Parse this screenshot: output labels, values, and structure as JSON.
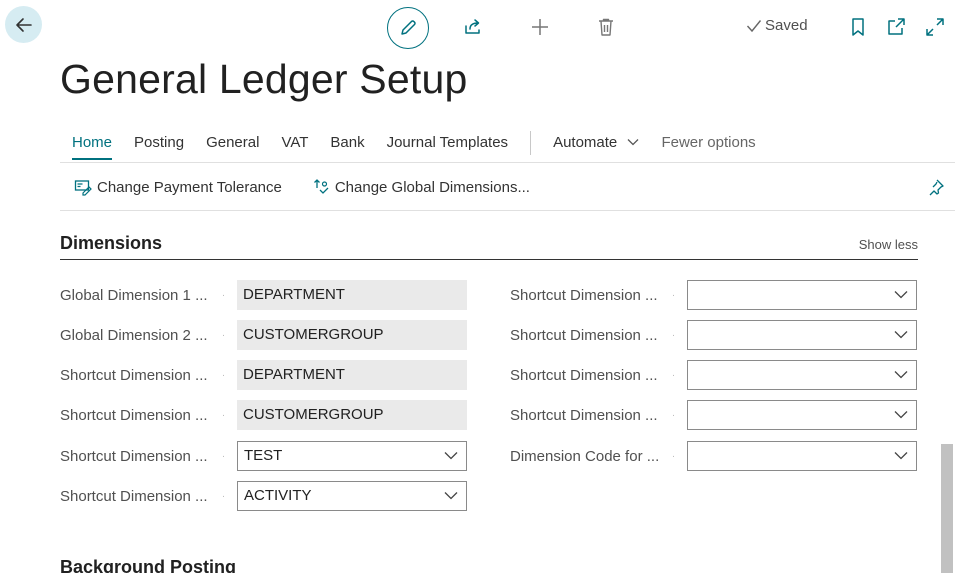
{
  "header": {
    "saved_label": "Saved",
    "page_title": "General Ledger Setup"
  },
  "tabs": {
    "home": "Home",
    "posting": "Posting",
    "general": "General",
    "vat": "VAT",
    "bank": "Bank",
    "journal_templates": "Journal Templates",
    "automate": "Automate",
    "fewer_options": "Fewer options"
  },
  "actions": {
    "change_payment_tolerance": "Change Payment Tolerance",
    "change_global_dimensions": "Change Global Dimensions..."
  },
  "section": {
    "title": "Dimensions",
    "toggle": "Show less"
  },
  "left_fields": [
    {
      "label": "Global Dimension 1 ...",
      "value": "DEPARTMENT"
    },
    {
      "label": "Global Dimension 2 ...",
      "value": "CUSTOMERGROUP"
    },
    {
      "label": "Shortcut Dimension ...",
      "value": "DEPARTMENT"
    },
    {
      "label": "Shortcut Dimension ...",
      "value": "CUSTOMERGROUP"
    },
    {
      "label": "Shortcut Dimension ...",
      "value": "TEST"
    },
    {
      "label": "Shortcut Dimension ...",
      "value": "ACTIVITY"
    }
  ],
  "right_fields": [
    {
      "label": "Shortcut Dimension ...",
      "value": ""
    },
    {
      "label": "Shortcut Dimension ...",
      "value": ""
    },
    {
      "label": "Shortcut Dimension ...",
      "value": ""
    },
    {
      "label": "Shortcut Dimension ...",
      "value": ""
    },
    {
      "label": "Dimension Code for ...",
      "value": ""
    }
  ],
  "next_section": {
    "title": "Background Posting"
  },
  "colors": {
    "accent": "#00717f",
    "back_button_bg": "#d6ecf2",
    "readonly_field_bg": "#eaeaea"
  },
  "icons": {
    "back": "arrow-left-icon",
    "edit": "pencil-icon",
    "share": "share-icon",
    "add": "plus-icon",
    "delete": "trash-icon",
    "saved": "checkmark-icon",
    "bookmark": "bookmark-icon",
    "open_new": "open-in-new-window-icon",
    "expand": "expand-icon",
    "payment_tolerance": "payment-tolerance-icon",
    "global_dimensions": "global-dimensions-icon",
    "pin": "pin-icon"
  }
}
